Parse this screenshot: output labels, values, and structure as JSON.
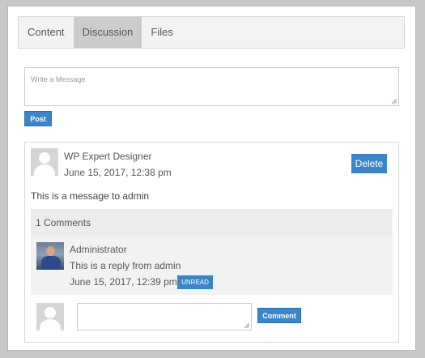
{
  "tabs": [
    {
      "label": "Content",
      "active": false
    },
    {
      "label": "Discussion",
      "active": true
    },
    {
      "label": "Files",
      "active": false
    }
  ],
  "compose": {
    "placeholder": "Write a Message",
    "post_label": "Post"
  },
  "post": {
    "author": "WP Expert Designer",
    "date": "June 15, 2017, 12:38 pm",
    "delete_label": "Delete",
    "message": "This is a message to admin",
    "comments_count": "1 Comments"
  },
  "reply": {
    "author": "Administrator",
    "text": "This is a reply from admin",
    "date": "June 15, 2017, 12:39 pm",
    "status": "UNREAD"
  },
  "new_comment": {
    "button_label": "Comment"
  },
  "colors": {
    "accent": "#3b85c9",
    "active_tab": "#cccccc"
  },
  "icons": {
    "default_avatar": "user-silhouette-icon",
    "resize_grip": "resize-grip-icon"
  }
}
